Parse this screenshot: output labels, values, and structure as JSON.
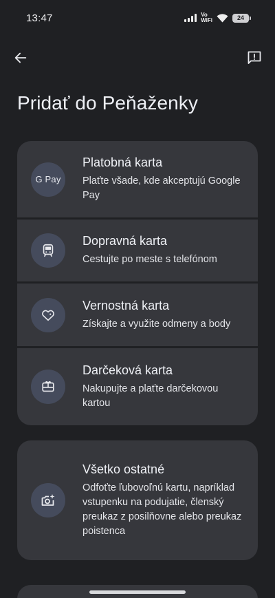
{
  "status_bar": {
    "time": "13:47",
    "vowifi_top": "Vo",
    "vowifi_bottom": "WiFi",
    "battery": "24"
  },
  "app_bar": {
    "back_icon": "arrow-back-icon",
    "feedback_icon": "feedback-icon"
  },
  "page": {
    "title": "Pridať do Peňaženky"
  },
  "items": [
    {
      "icon": "gpay-logo",
      "icon_text": "G Pay",
      "title": "Platobná karta",
      "desc": "Plaťte všade, kde akceptujú Google Pay"
    },
    {
      "icon": "train-icon",
      "title": "Dopravná karta",
      "desc": "Cestujte po meste s telefónom"
    },
    {
      "icon": "heart-tag-icon",
      "title": "Vernostná karta",
      "desc": "Získajte a využite odmeny a body"
    },
    {
      "icon": "gift-card-icon",
      "title": "Darčeková karta",
      "desc": "Nakupujte a plaťte darčekovou kartou"
    },
    {
      "icon": "camera-sparkle-icon",
      "title": "Všetko ostatné",
      "desc": "Odfoťte ľubovoľnú kartu, napríklad vstupenku na podujatie, členský preukaz z posilňovne alebo preukaz poistenca"
    }
  ],
  "colors": {
    "background": "#1f2023",
    "card": "#36373c",
    "icon_circle": "#454b5c",
    "text": "#eef0f5"
  }
}
